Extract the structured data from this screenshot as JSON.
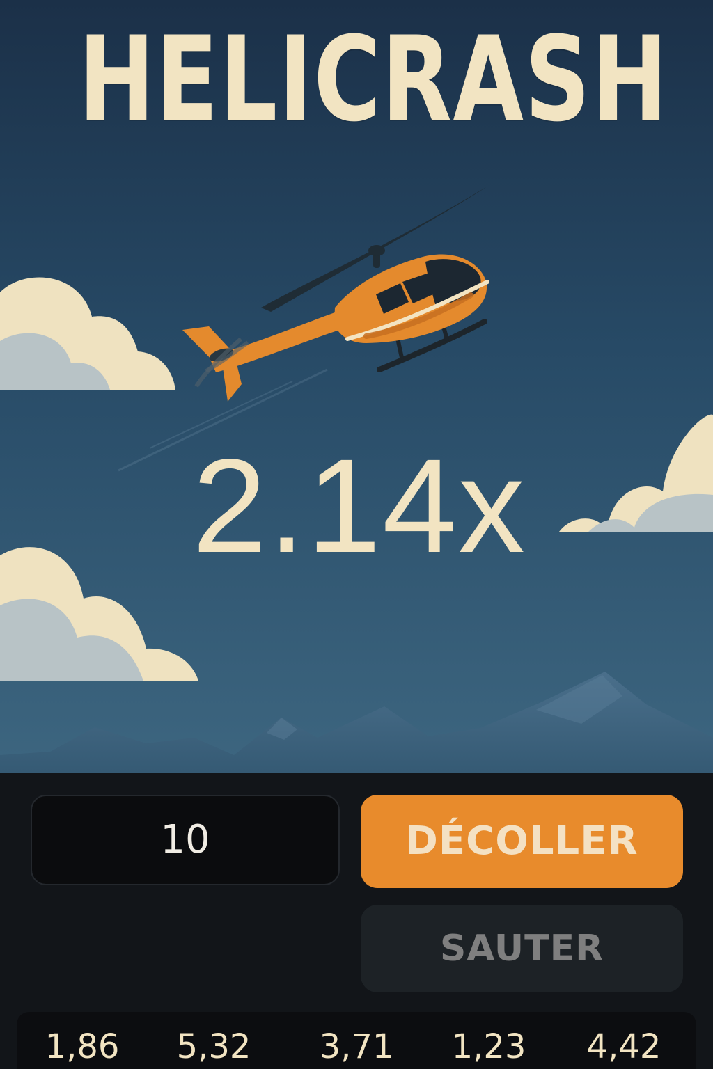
{
  "game": {
    "title": "HELICRASH",
    "multiplier": "2.14x"
  },
  "controls": {
    "bet_value": "10",
    "takeoff_label": "DÉCOLLER",
    "jump_label": "SAUTER"
  },
  "history": [
    "1,86",
    "5,32",
    "3,71",
    "1,23",
    "4,42"
  ],
  "colors": {
    "sky_top": "#1b3048",
    "sky_bottom": "#3d6680",
    "cream": "#f2e4c2",
    "accent": "#e88b2c",
    "panel": "#121519",
    "input_bg": "#0b0c0e",
    "disabled_button": "#1d2226"
  },
  "icons": {
    "helicopter": "helicopter-icon",
    "clouds": "cloud-icon",
    "mountains": "mountain-icon"
  }
}
